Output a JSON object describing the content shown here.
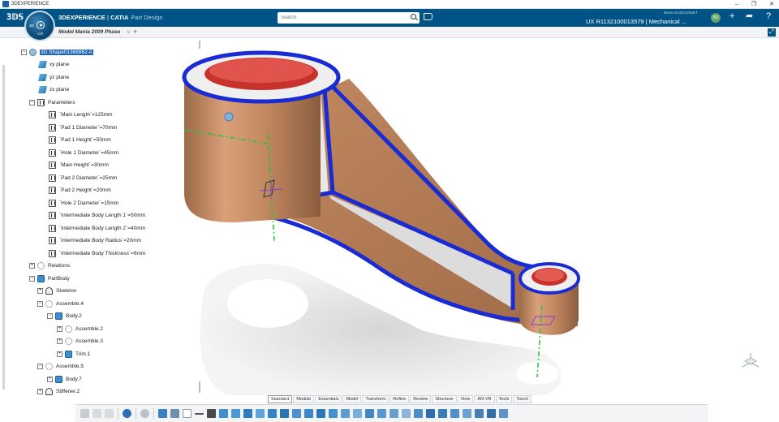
{
  "os": {
    "title": "3DEXPERIENCE",
    "controls": [
      "–",
      "❐",
      "✕"
    ]
  },
  "header": {
    "brand_prefix": "3DEXPERIENCE",
    "brand_sep": " | ",
    "brand_catia": "CATIA",
    "app_name": "Part Design",
    "compass_labels": [
      "3D",
      "V,R"
    ],
    "search_placeholder": "Search",
    "user_name": "Bruno DUGOUSSET",
    "context": "UX R1132100013579 | Mechanical ...",
    "avatar_initials": "BD",
    "icons": [
      "tag-icon",
      "plus-icon",
      "share-icon",
      "communicate-icon",
      "help-icon"
    ]
  },
  "tab_strip": {
    "tab_label": "Model Mania 2009 Phase",
    "tab_chevron": "∨",
    "add_label": "+"
  },
  "tree": {
    "root": "3D Shape01368862 A",
    "planes": [
      "xy plane",
      "yz plane",
      "zx plane"
    ],
    "parameters_label": "Parameters",
    "parameters": [
      "`Main Length`=125mm",
      "`Pad 1 Diameter`=70mm",
      "`Pad 1 Height`=50mm",
      "`Hole 1 Diameter`=45mm",
      "`Main Height`=30mm",
      "`Pad 2 Diameter`=25mm",
      "`Pad 2 Height`=20mm",
      "`Hole 2 Diameter`=15mm",
      "`Intermediate Body Length 1`=50mm",
      "`Intermediate Body Length 2`=40mm",
      "`Intermediate Body Radius`=20mm",
      "`Intermediate Body Thickness`=6mm"
    ],
    "relations": "Relations",
    "partbody": "PartBody",
    "skeleton": "Skeleton",
    "assemble4": "Assemble.4",
    "body2": "Body.2",
    "assemble2": "Assemble.2",
    "assemble3": "Assemble.3",
    "trim1": "Trim.1",
    "assemble5": "Assemble.5",
    "body7": "Body.7",
    "stiffener2": "Stiffener.2"
  },
  "section_tabs": [
    "Standard",
    "Module",
    "Essentials",
    "Model",
    "Transform",
    "Refine",
    "Review",
    "Structure",
    "View",
    "AR-VR",
    "Tools",
    "Touch"
  ],
  "active_section": "Essentials",
  "colors": {
    "header_bg": "#005386",
    "part_copper": "#c98a5c",
    "part_edge": "#1a2bd4",
    "hole_red": "#c8322d",
    "axis_green": "#22c53b"
  }
}
